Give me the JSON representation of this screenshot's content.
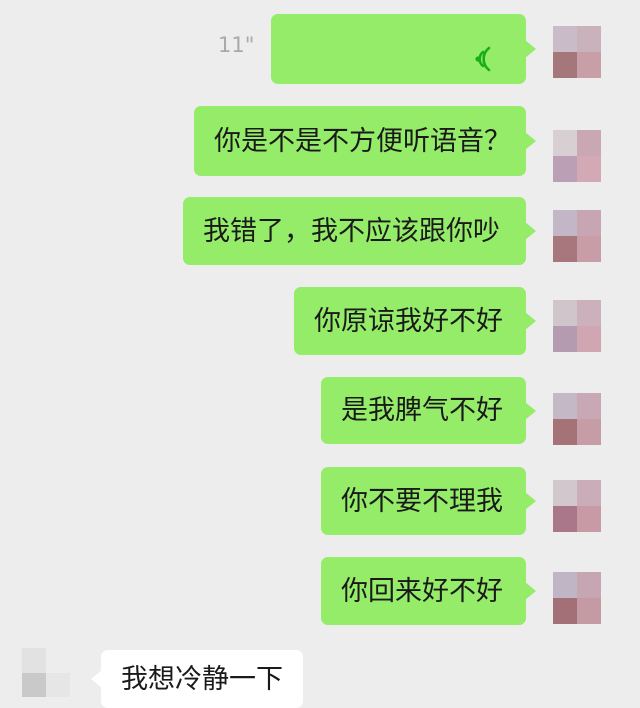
{
  "messages": [
    {
      "type": "voice",
      "duration": "11\"",
      "direction": "sent"
    },
    {
      "type": "text",
      "text": "你是不是不方便听语音？",
      "direction": "sent"
    },
    {
      "type": "text",
      "text": "我错了，我不应该跟你吵",
      "direction": "sent"
    },
    {
      "type": "text",
      "text": "你原谅我好不好",
      "direction": "sent"
    },
    {
      "type": "text",
      "text": "是我脾气不好",
      "direction": "sent"
    },
    {
      "type": "text",
      "text": "你不要不理我",
      "direction": "sent"
    },
    {
      "type": "text",
      "text": "你回来好不好",
      "direction": "sent"
    },
    {
      "type": "text",
      "text": "我想冷静一下",
      "direction": "received"
    }
  ],
  "colors": {
    "background": "#ededed",
    "sent_bubble": "#95ec69",
    "received_bubble": "#ffffff",
    "voice_icon": "#1aad19"
  },
  "icons": {
    "voice": "voice-wave-icon",
    "avatar": "pixelated-avatar"
  }
}
